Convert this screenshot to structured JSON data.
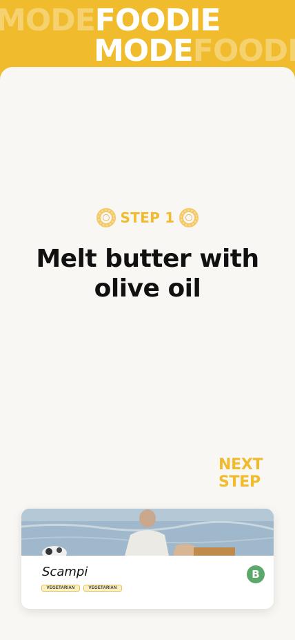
{
  "banner": {
    "top_ghost": "MODE FOODIE",
    "row1_ghost": "MODE",
    "row1_solid": "FOODIE",
    "row2_solid": "MODE",
    "row2_ghost": "FOODIE"
  },
  "step": {
    "label": "STEP 1",
    "icon": "donut-icon"
  },
  "instruction": "Melt butter with olive oil",
  "next_step_label": "NEXT STEP",
  "recipe": {
    "name": "Scampi",
    "tags": [
      "VEGETARIAN",
      "VEGETARIAN"
    ],
    "badge": "B"
  },
  "colors": {
    "accent": "#F0BB2C",
    "background": "#F9F7F3",
    "badge": "#5CA86C"
  }
}
